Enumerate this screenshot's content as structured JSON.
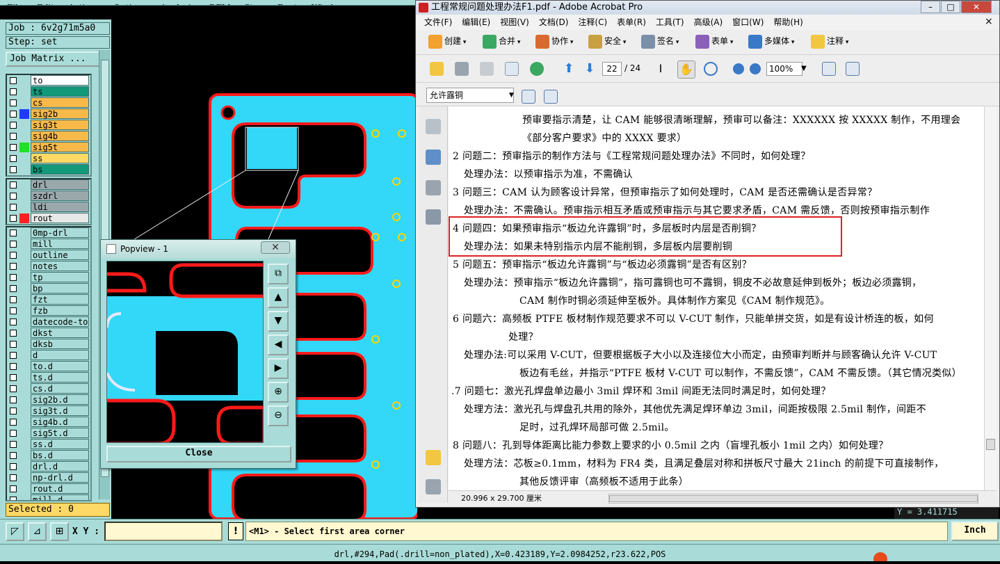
{
  "genesis": {
    "menu": [
      "File",
      "Edit",
      "Actions",
      "Options",
      "Analysis",
      "DFM",
      "Step",
      "Rout",
      "Windows"
    ],
    "job_label": "Job : 6v2g71m5a0",
    "step_label": "Step: set",
    "job_matrix": "Job Matrix ...",
    "layers_top": [
      {
        "name": "to",
        "bg": "#ffffff",
        "swatch": ""
      },
      {
        "name": "ts",
        "bg": "#11997a",
        "swatch": ""
      },
      {
        "name": "cs",
        "bg": "#f7b94a",
        "swatch": ""
      },
      {
        "name": "sig2b",
        "bg": "#f7b94a",
        "swatch": "#1e3cff"
      },
      {
        "name": "sig3t",
        "bg": "#f7b94a",
        "swatch": ""
      },
      {
        "name": "sig4b",
        "bg": "#f7b94a",
        "swatch": ""
      },
      {
        "name": "sig5t",
        "bg": "#f7b94a",
        "swatch": "#22e022"
      },
      {
        "name": "ss",
        "bg": "#ffd966",
        "swatch": ""
      },
      {
        "name": "bs",
        "bg": "#11997a",
        "swatch": ""
      }
    ],
    "layers_drill": [
      {
        "name": "drl",
        "bg": "#9aa8ac",
        "swatch": ""
      },
      {
        "name": "szdrl",
        "bg": "#9aa8ac",
        "swatch": ""
      },
      {
        "name": "ldi",
        "bg": "#9aa8ac",
        "swatch": ""
      },
      {
        "name": "rout",
        "bg": "#e8e8e8",
        "swatch": "#ff2020"
      }
    ],
    "layers_misc": [
      "0mp-drl",
      "mill",
      "outline",
      "notes",
      "tp",
      "bp",
      "fzt",
      "fzb",
      "datecode-to",
      "dkst",
      "dksb",
      "d",
      "to.d",
      "ts.d",
      "cs.d",
      "sig2b.d",
      "sig3t.d",
      "sig4b.d",
      "sig5t.d",
      "ss.d",
      "bs.d",
      "drl.d",
      "np-drl.d",
      "rout.d",
      "mill.d"
    ],
    "selected": "Selected : 0",
    "xy_label": "X Y :",
    "xy_value": "",
    "excl": "!",
    "prompt": "<M1> - Select first area corner",
    "unit": "Inch",
    "status": "drl,#294,Pad(.drill=non_plated),X=0.423189,Y=2.0984252,r23.622,POS",
    "coord_readout": "Y = 3.411715",
    "popview": {
      "title": "Popview - 1",
      "close": "Close",
      "close_icon": "✕"
    }
  },
  "acrobat": {
    "title": "工程常规问题处理办法F1.pdf - Adobe Acrobat Pro",
    "menu": [
      "文件(F)",
      "编辑(E)",
      "视图(V)",
      "文档(D)",
      "注释(C)",
      "表单(R)",
      "工具(T)",
      "高级(A)",
      "窗口(W)",
      "帮助(H)"
    ],
    "menu_close": "×",
    "toolbar1": [
      "创建",
      "合并",
      "协作",
      "安全",
      "签名",
      "表单",
      "多媒体",
      "注释"
    ],
    "page_current": "22",
    "page_total": "/ 24",
    "zoom": "100%",
    "bookmark": "允许露铜",
    "page_size": "20.996 x 29.700 厘米",
    "lines": [
      "预审要指示清楚，让 CAM 能够很清晰理解，预审可以备注：XXXXXX 按 XXXXX 制作，不用理会",
      "《部分客户要求》中的 XXXX 要求）",
      "2 问题二：预审指示的制作方法与《工程常规问题处理办法》不同时，如何处理？",
      "处理办法：以预审指示为准，不需确认",
      "3 问题三：CAM 认为顾客设计异常，但预审指示了如何处理时，CAM 是否还需确认是否异常？",
      "处理办法：不需确认。预审指示相互矛盾或预审指示与其它要求矛盾，CAM 需反馈，否则按预审指示制作",
      "4 问题四：如果预审指示“板边允许露铜”时，多层板时内层是否削铜？",
      "处理办法：如果未特别指示内层不能削铜，多层板内层要削铜",
      "5 问题五：预审指示“板边允许露铜”与“板边必须露铜”是否有区别？",
      "处理办法：预审指示“板边允许露铜”，指可露铜也可不露铜，铜皮不必故意延伸到板外；板边必须露铜，",
      "CAM 制作时铜必须延伸至板外。具体制作方案见《CAM 制作规范》。",
      "6 问题六：高频板 PTFE 板材制作规范要求不可以 V-CUT 制作，只能单拼交货，如是有设计桥连的板，如何",
      "处理？",
      "处理办法:可以采用 V-CUT，但要根据板子大小以及连接位大小而定，由预审判断并与顾客确认允许 V-CUT",
      "板边有毛丝，并指示“PTFE 板材 V-CUT 可以制作，不需反馈”，CAM 不需反馈。（其它情况类似）",
      ".7 问题七：激光孔焊盘单边最小 3mil 焊环和 3mil 间距无法同时满足时，如何处理？",
      "处理方法：激光孔与焊盘孔共用的除外，其他优先满足焊环单边 3mil，间距按极限 2.5mil 制作，间距不",
      "足时，过孔焊环局部可做 2.5mil。",
      "8 问题八：孔到导体距离比能力参数上要求的小 0.5mil 之内（盲埋孔板小 1mil 之内）如何处理？",
      "处理方法：芯板≥0.1mm，材料为 FR4 类，且满足叠层对称和拼板尺寸最大 21inch 的前提下可直接制作，",
      "其他反馈评审（高频板不适用于此条）"
    ]
  }
}
